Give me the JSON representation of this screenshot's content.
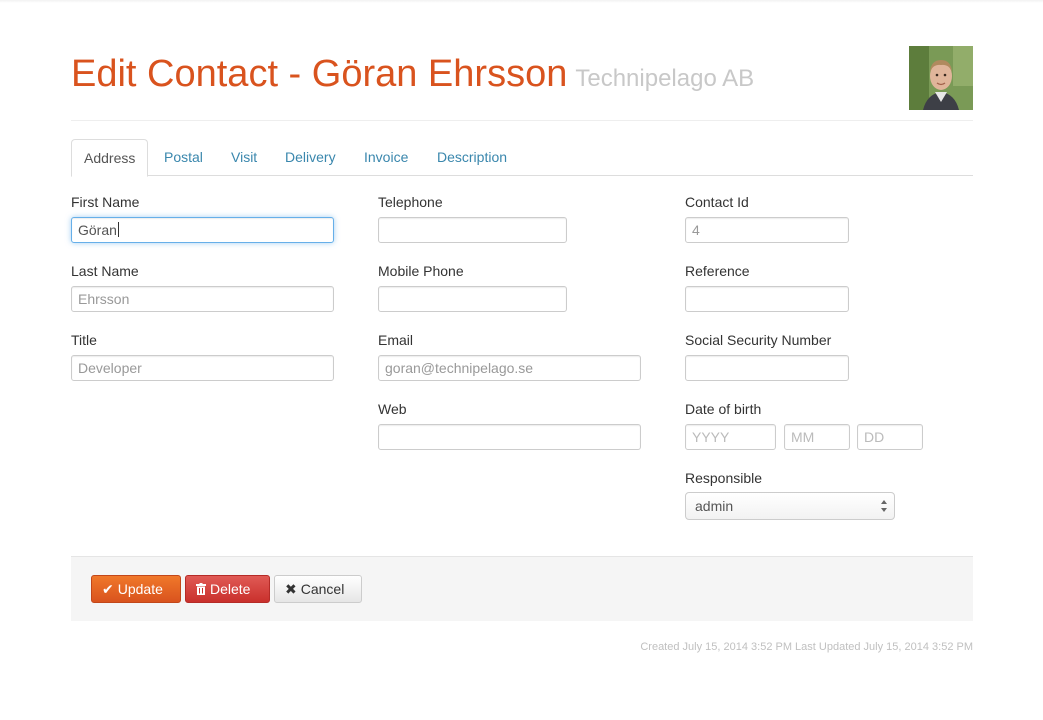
{
  "header": {
    "title": "Edit Contact - Göran Ehrsson",
    "company": "Technipelago AB"
  },
  "tabs": [
    {
      "label": "Address",
      "active": true
    },
    {
      "label": "Postal"
    },
    {
      "label": "Visit"
    },
    {
      "label": "Delivery"
    },
    {
      "label": "Invoice"
    },
    {
      "label": "Description"
    }
  ],
  "form": {
    "first_name": {
      "label": "First Name",
      "value": "Göran"
    },
    "last_name": {
      "label": "Last Name",
      "value": "Ehrsson"
    },
    "title": {
      "label": "Title",
      "value": "Developer"
    },
    "telephone": {
      "label": "Telephone",
      "value": ""
    },
    "mobile_phone": {
      "label": "Mobile Phone",
      "value": ""
    },
    "email": {
      "label": "Email",
      "value": "goran@technipelago.se"
    },
    "web": {
      "label": "Web",
      "value": ""
    },
    "contact_id": {
      "label": "Contact Id",
      "value": "4"
    },
    "reference": {
      "label": "Reference",
      "value": ""
    },
    "ssn": {
      "label": "Social Security Number",
      "value": ""
    },
    "dob": {
      "label": "Date of birth",
      "year_placeholder": "YYYY",
      "month_placeholder": "MM",
      "day_placeholder": "DD"
    },
    "responsible": {
      "label": "Responsible",
      "value": "admin"
    }
  },
  "actions": {
    "update": "Update",
    "delete": "Delete",
    "cancel": "Cancel"
  },
  "meta": "Created July 15, 2014 3:52 PM Last Updated July 15, 2014 3:52 PM",
  "icons": {
    "update": "check-icon",
    "delete": "trash-icon",
    "cancel": "close-icon"
  },
  "colors": {
    "title": "#d9531e",
    "link": "#3a87ad",
    "update": "#e8692a",
    "delete": "#d43f3a"
  }
}
